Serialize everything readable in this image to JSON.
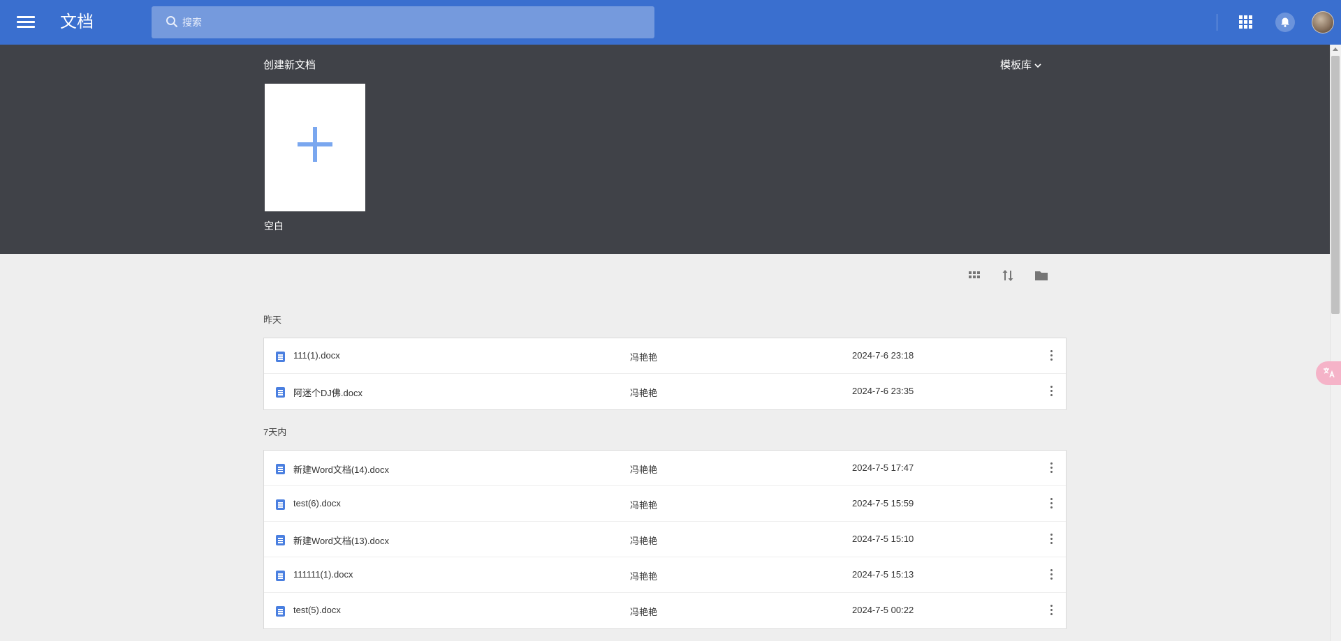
{
  "header": {
    "title": "文档",
    "search_placeholder": "搜索",
    "icons": [
      "menu-icon",
      "search-icon",
      "apps-grid-icon",
      "bell-icon",
      "avatar"
    ],
    "brand_color": "#3a6fcf"
  },
  "create": {
    "title": "创建新文档",
    "template_library": "模板库",
    "blank_label": "空白",
    "background": "#404248",
    "plus_color": "#7aa7ef"
  },
  "toolbar": {
    "icons": [
      "grid-view-icon",
      "sort-icon",
      "folder-icon"
    ]
  },
  "sections": [
    {
      "label": "昨天",
      "files": [
        {
          "name": "111(1).docx",
          "owner": "冯艳艳",
          "date": "2024-7-6 23:18"
        },
        {
          "name": "阿迷个DJ佛.docx",
          "owner": "冯艳艳",
          "date": "2024-7-6 23:35"
        }
      ]
    },
    {
      "label": "7天内",
      "files": [
        {
          "name": "新建Word文档(14).docx",
          "owner": "冯艳艳",
          "date": "2024-7-5 17:47"
        },
        {
          "name": "test(6).docx",
          "owner": "冯艳艳",
          "date": "2024-7-5 15:59"
        },
        {
          "name": "新建Word文档(13).docx",
          "owner": "冯艳艳",
          "date": "2024-7-5 15:10"
        },
        {
          "name": "111111(1).docx",
          "owner": "冯艳艳",
          "date": "2024-7-5 15:13"
        },
        {
          "name": "test(5).docx",
          "owner": "冯艳艳",
          "date": "2024-7-5 00:22"
        }
      ]
    }
  ],
  "doc_icon_color": "#4a7fe0"
}
